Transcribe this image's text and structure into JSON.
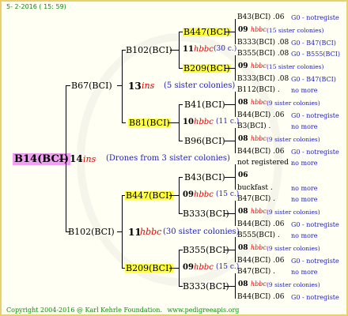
{
  "header": {
    "date": "5-  2-2016 ( 15: 59)"
  },
  "footer": {
    "copyright": "Copyright 2004-2016 @ Karl Kehrle Foundation.",
    "site": "www.pedigreeapis.org"
  },
  "root": {
    "label": "B14(BCI)",
    "num": "14",
    "mark": "ins",
    "note": "(Drones from 3 sister colonies)"
  },
  "gen1": {
    "top": {
      "label": "B67(BCI)",
      "num": "13",
      "mark": "ins",
      "note": "(5 sister colonies)"
    },
    "bottom": {
      "label": "B102(BCI)",
      "num": "11",
      "mark": "hbbc",
      "note": "(30 sister colonies)"
    }
  },
  "gen2": {
    "a": {
      "label": "B102(BCI)",
      "num": "11",
      "mark": "hbbc",
      "note": "(30 c.)"
    },
    "b": {
      "label": "B81(BCI)",
      "num": "10",
      "mark": "hbbc",
      "note": "(11 c.)"
    },
    "c": {
      "label": "B447(BCI)",
      "num": "09",
      "mark": "hbbc",
      "note": "(15 c.)"
    },
    "d": {
      "label": "B209(BCI)",
      "num": "09",
      "mark": "hbbc",
      "note": "(15 c.)"
    }
  },
  "gen3": {
    "a1": "B447(BCI)",
    "a2": "B209(BCI)",
    "b1": "B41(BCI)",
    "b2": "B96(BCI)",
    "c1": "B43(BCI)",
    "c2": "B333(BCI)",
    "d1": "B355(BCI)",
    "d2": "B333(BCI)"
  },
  "gen4": [
    {
      "top": "B43(BCI) .06",
      "topr": "G0 - notregiste",
      "num": "09",
      "mark": "hbbc",
      "note": "(15 sister colonies)",
      "bot": "B333(BCI) .08",
      "botr": "G0 - B47(BCI)"
    },
    {
      "top": "B355(BCI) .08",
      "topr": "G0 - B555(BCI)",
      "num": "09",
      "mark": "hbbc",
      "note": "(15 sister colonies)",
      "bot": "B333(BCI) .08",
      "botr": "G0 - B47(BCI)"
    },
    {
      "top": "B112(BCI) .",
      "topr": "no more",
      "num": "08",
      "mark": "hbbc",
      "note": "(9 sister colonies)",
      "bot": "B44(BCI) .06",
      "botr": "G0 - notregiste"
    },
    {
      "top": "B3(BCI) .",
      "topr": "no more",
      "num": "08",
      "mark": "hbbc",
      "note": "(9 sister colonies)",
      "bot": "B44(BCI) .06",
      "botr": "G0 - notregiste"
    },
    {
      "top": "not registered .",
      "topr": "no more",
      "num": "06",
      "mark": "",
      "note": "",
      "bot": "buckfast .",
      "botr": "no more"
    },
    {
      "top": "B47(BCI) .",
      "topr": "no more",
      "num": "08",
      "mark": "hbbc",
      "note": "(9 sister colonies)",
      "bot": "B44(BCI) .06",
      "botr": "G0 - notregiste"
    },
    {
      "top": "B555(BCI) .",
      "topr": "no more",
      "num": "08",
      "mark": "hbbc",
      "note": "(9 sister colonies)",
      "bot": "B44(BCI) .06",
      "botr": "G0 - notregiste"
    },
    {
      "top": "B47(BCI) .",
      "topr": "no more",
      "num": "08",
      "mark": "hbbc",
      "note": "(9 sister colonies)",
      "bot": "B44(BCI) .06",
      "botr": "G0 - notregiste"
    }
  ]
}
